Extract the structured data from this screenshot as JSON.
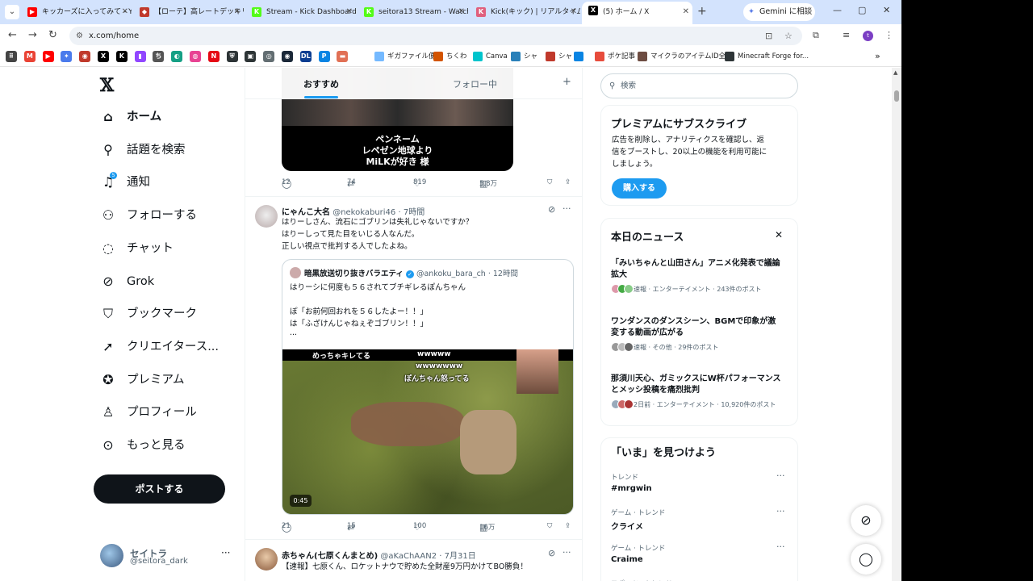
{
  "browser": {
    "tabs": [
      {
        "title": "キッカーズに入ってみて - You",
        "icon": "youtube-icon",
        "color": "#ff0000",
        "glyph": "▶"
      },
      {
        "title": "【ローテ】高レートデッキリスト",
        "icon": "shadowverse-icon",
        "color": "#c0392b",
        "glyph": "◆"
      },
      {
        "title": "Stream - Kick Dashboard",
        "icon": "kick-icon",
        "color": "#53fc18",
        "glyph": "K"
      },
      {
        "title": "seitora13 Stream - Watch",
        "icon": "kick-icon",
        "color": "#53fc18",
        "glyph": "K"
      },
      {
        "title": "Kick(キック) | リアルタイム",
        "icon": "kick-news-icon",
        "color": "#e0607e",
        "glyph": "K"
      },
      {
        "title": "(5) ホーム / X",
        "icon": "x-icon",
        "color": "#000000",
        "glyph": "X"
      }
    ],
    "gemini_label": "Gemini に相談",
    "url": "x.com/home"
  },
  "bookmarks": [
    {
      "icon": "apps-icon",
      "color": "#444444",
      "glyph": "⠿"
    },
    {
      "icon": "gmail-icon",
      "color": "#ea4335",
      "glyph": "M"
    },
    {
      "icon": "youtube-icon",
      "color": "#ff0000",
      "glyph": "▶"
    },
    {
      "icon": "gemini-icon",
      "color": "#4b7bec",
      "glyph": "✦"
    },
    {
      "icon": "bookmark-icon-4",
      "color": "#c0392b",
      "glyph": "◉"
    },
    {
      "icon": "x-icon",
      "color": "#000000",
      "glyph": "X"
    },
    {
      "icon": "kick-icon",
      "color": "#000000",
      "glyph": "K"
    },
    {
      "icon": "twitch-icon",
      "color": "#9146ff",
      "glyph": "▮"
    },
    {
      "icon": "bookmark-icon-8",
      "color": "#555555",
      "glyph": "ち"
    },
    {
      "icon": "bookmark-icon-9",
      "color": "#16a085",
      "glyph": "◐"
    },
    {
      "icon": "bookmark-icon-10",
      "color": "#e84393",
      "glyph": "◍"
    },
    {
      "icon": "netflix-icon",
      "color": "#e50914",
      "glyph": "N"
    },
    {
      "icon": "shield-icon",
      "color": "#2d3436",
      "glyph": "⛨"
    },
    {
      "icon": "bookmark-icon-13",
      "color": "#2d3436",
      "glyph": "▣"
    },
    {
      "icon": "bookmark-icon-14",
      "color": "#636e72",
      "glyph": "◎"
    },
    {
      "icon": "steam-icon",
      "color": "#1b2838",
      "glyph": "◉"
    },
    {
      "icon": "dlsite-icon",
      "color": "#0b3d91",
      "glyph": "DL"
    },
    {
      "icon": "bookmark-icon-17",
      "color": "#0984e3",
      "glyph": "P"
    },
    {
      "icon": "bookmark-icon-18",
      "color": "#e17055",
      "glyph": "▬"
    }
  ],
  "bookmarks_named": [
    {
      "label": "ギガファイル便",
      "icon": "gigafile-icon",
      "color": "#74b9ff"
    },
    {
      "label": "ちくわ",
      "icon": "chikuwa-icon",
      "color": "#d35400"
    },
    {
      "label": "Canva",
      "icon": "canva-icon",
      "color": "#00c4cc"
    },
    {
      "label": "シャ",
      "icon": "sha-icon",
      "color": "#2980b9"
    },
    {
      "label": "シャ",
      "icon": "sha-icon-2",
      "color": "#c0392b"
    },
    {
      "label": "",
      "icon": "bookmark-icon-t",
      "color": "#0984e3"
    },
    {
      "label": "ポケ記事",
      "icon": "pokemon-icon",
      "color": "#e74c3c"
    },
    {
      "label": "マイクラのアイテムID全...",
      "icon": "minecraft-icon",
      "color": "#6d4c41"
    },
    {
      "label": "Minecraft Forge for...",
      "icon": "forge-icon",
      "color": "#2d3436"
    }
  ],
  "sidebar": {
    "items": [
      {
        "label": "ホーム",
        "icon": "home-icon",
        "glyph": "⌂",
        "active": true
      },
      {
        "label": "話題を検索",
        "icon": "search-icon",
        "glyph": "⚲"
      },
      {
        "label": "通知",
        "icon": "bell-icon",
        "glyph": "♫",
        "badge": "5"
      },
      {
        "label": "フォローする",
        "icon": "follow-icon",
        "glyph": "⚇"
      },
      {
        "label": "チャット",
        "icon": "chat-icon",
        "glyph": "◌"
      },
      {
        "label": "Grok",
        "icon": "grok-icon",
        "glyph": "⊘"
      },
      {
        "label": "ブックマーク",
        "icon": "bookmark-icon",
        "glyph": "⛉"
      },
      {
        "label": "クリエイタース...",
        "icon": "rocket-icon",
        "glyph": "➚"
      },
      {
        "label": "プレミアム",
        "icon": "premium-icon",
        "glyph": "✪"
      },
      {
        "label": "プロフィール",
        "icon": "profile-icon",
        "glyph": "♙"
      },
      {
        "label": "もっと見る",
        "icon": "more-icon",
        "glyph": "⊙"
      }
    ],
    "post_button": "ポストする",
    "account": {
      "name": "セイトラ",
      "handle": "@seitora_dark"
    }
  },
  "timeline": {
    "tabs": [
      "おすすめ",
      "フォロー中"
    ],
    "post0": {
      "media_caption": [
        "ペンネーム",
        "レペゼン地球より",
        "MiLKが好き 様"
      ],
      "replies": "12",
      "reposts": "74",
      "likes": "819",
      "views": "5.8万"
    },
    "post1": {
      "name": "にゃんこ大名",
      "handle": "@nekokaburi46",
      "time": "· 7時間",
      "lines": [
        "はりーしさん、流石にゴブリンは失礼じゃないですか？",
        "はりーしって見た目をいじる人なんだ。",
        "正しい視点で批判する人でしたよね。"
      ],
      "quote": {
        "name": "暗黒放送切り抜きバラエティ",
        "handle": "@ankoku_bara_ch",
        "time": "· 12時間",
        "lines": [
          "はりーシに何度も５６されてブチギレるぽんちゃん",
          "",
          "ぽ「お前何回おれを５６したよー！！」",
          "は「ふざけんじゃねぇぞゴブリン！！」",
          "..."
        ],
        "video_text": [
          "めっちゃキレてる",
          "wwwww",
          "wwwwwww",
          "ぽんちゃん怒ってる"
        ],
        "duration": "0:45"
      },
      "replies": "21",
      "reposts": "15",
      "likes": "100",
      "views": "16万"
    },
    "post2": {
      "name": "赤ちゃん(七原くんまとめ)",
      "handle": "@aKaChAAN2",
      "time": "· 7月31日",
      "text": "【速報】七原くん、ロケットナウで貯めた全財産9万円かけてBO勝負！"
    }
  },
  "right": {
    "search_placeholder": "検索",
    "premium": {
      "title": "プレミアムにサブスクライブ",
      "desc": [
        "広告を削除し、アナリティクスを確認し、返",
        "信をブーストし、20以上の機能を利用可能に",
        "しましょう。"
      ],
      "button": "購入する"
    },
    "news": {
      "title": "本日のニュース",
      "items": [
        {
          "headline": [
            "「みいちゃんと山田さん」アニメ化発表で議論",
            "拡大"
          ],
          "meta": "速報 · エンターテイメント · 243件のポスト"
        },
        {
          "headline": [
            "ワンダンスのダンスシーン、BGMで印象が激",
            "変する動画が広がる"
          ],
          "meta": "速報 · その他 · 29件のポスト"
        },
        {
          "headline": [
            "那須川天心、ガミックスにW杯パフォーマンス",
            "とメッシ投稿を痛烈批判"
          ],
          "meta": "2日前 · エンターテイメント · 10,920件のポスト"
        }
      ]
    },
    "trends": {
      "title": "「いま」を見つけよう",
      "items": [
        {
          "sub": "トレンド",
          "name": "#mrgwin"
        },
        {
          "sub": "ゲーム · トレンド",
          "name": "クライメ"
        },
        {
          "sub": "ゲーム · トレンド",
          "name": "Craime"
        },
        {
          "sub": "スポーツ · トレンド",
          "name": ""
        }
      ]
    }
  }
}
